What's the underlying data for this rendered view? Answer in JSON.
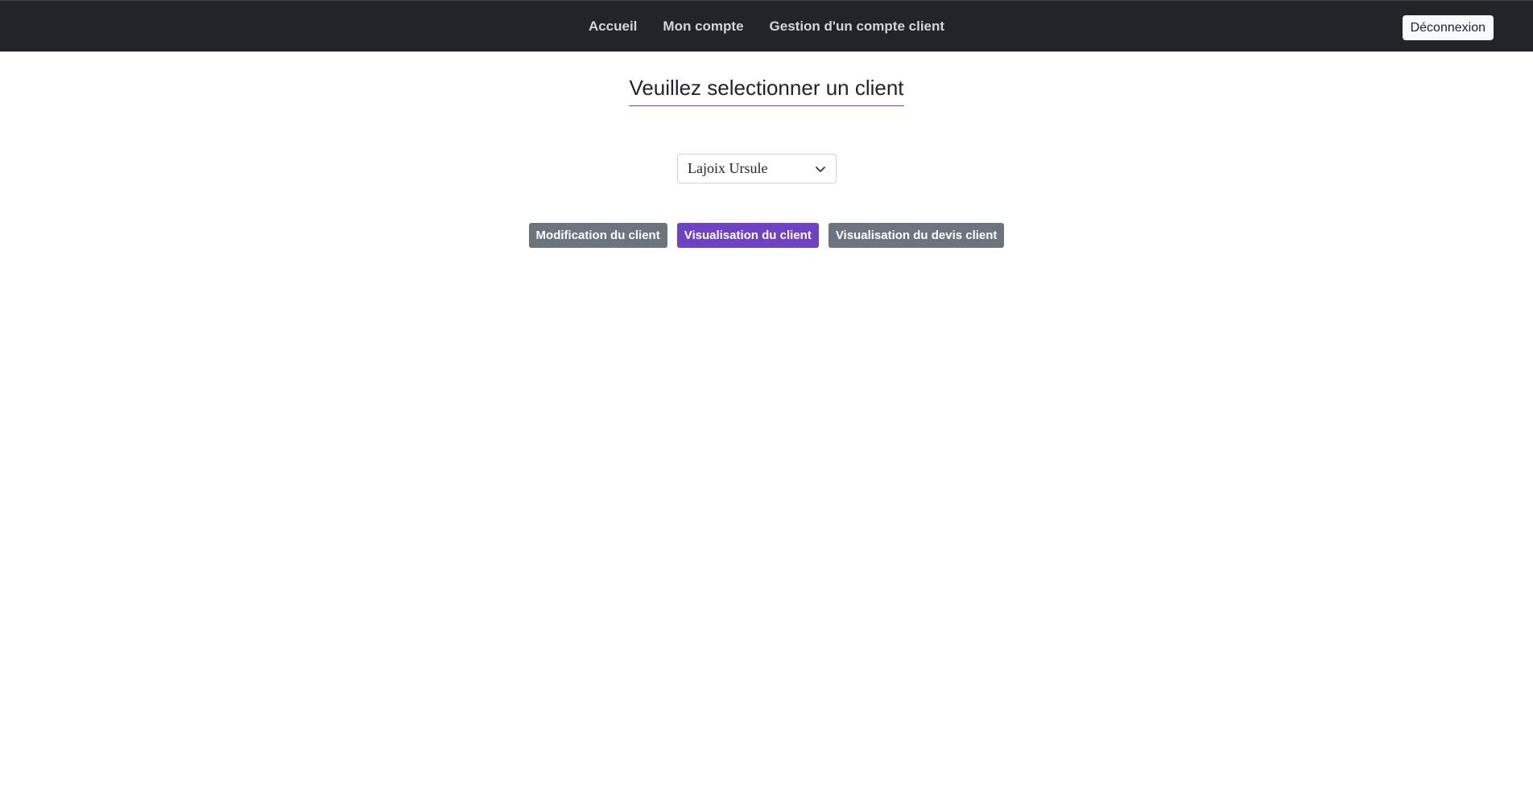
{
  "nav": {
    "links": [
      "Accueil",
      "Mon compte",
      "Gestion d'un compte client"
    ],
    "logout_label": "Déconnexion"
  },
  "main": {
    "title": "Veuillez selectionner un client",
    "client_select": {
      "selected": "Lajoix Ursule"
    },
    "buttons": {
      "modify": "Modification du client",
      "view": "Visualisation du client",
      "quote": "Visualisation du devis client"
    }
  },
  "colors": {
    "navbar": "#212529",
    "accent": "#6f42c1",
    "secondary": "#6c757d"
  }
}
